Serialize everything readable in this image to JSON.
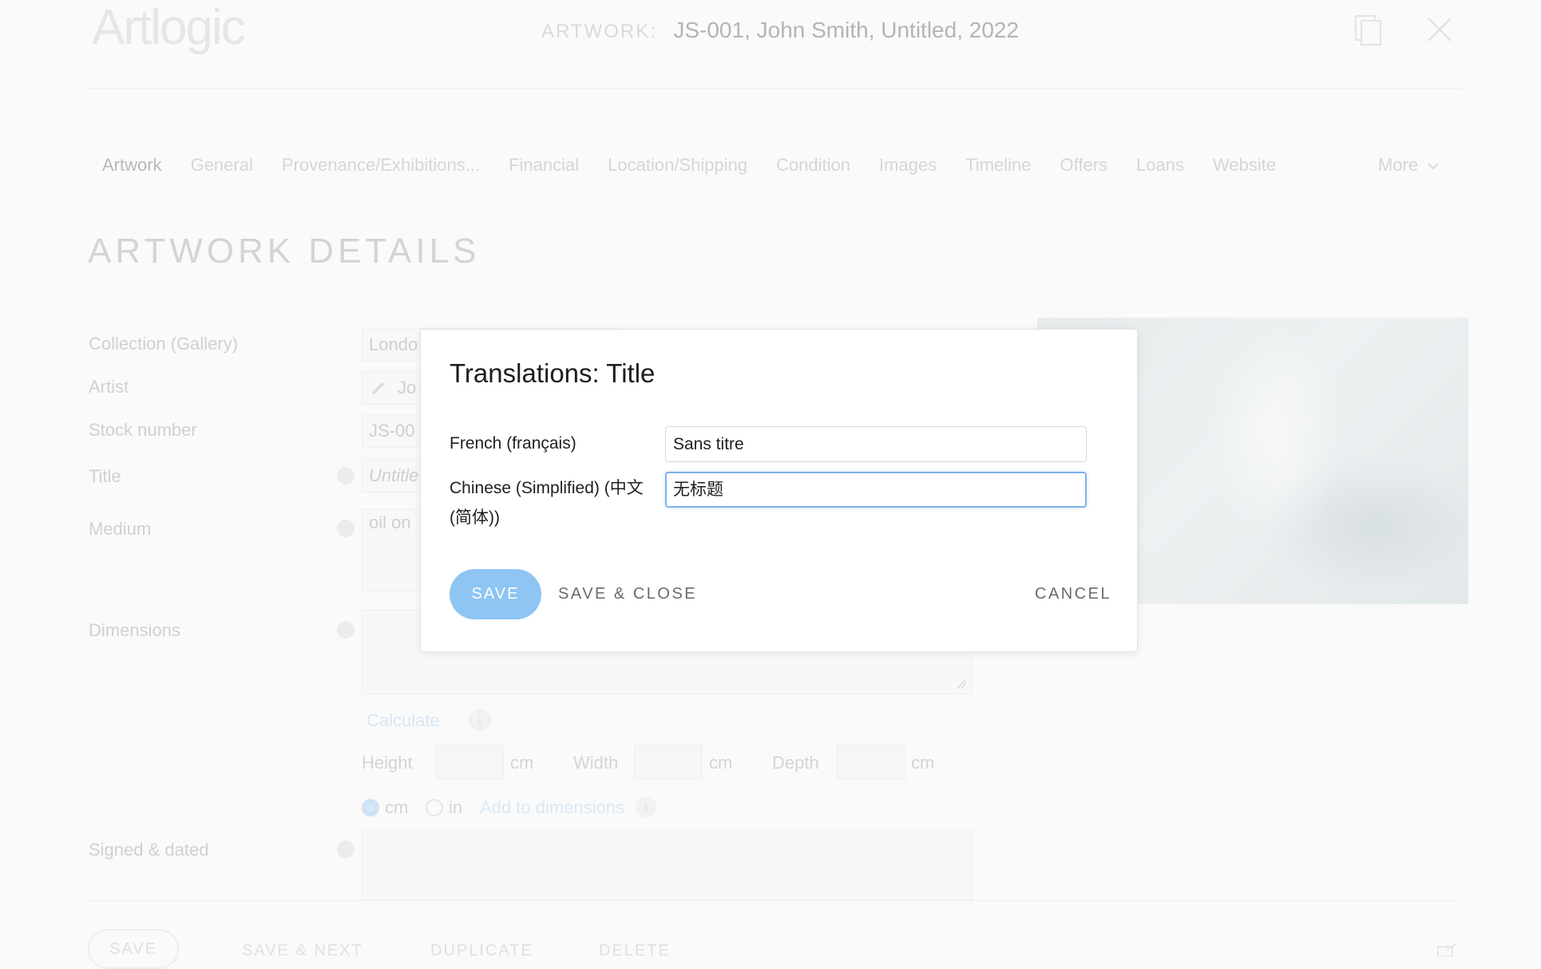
{
  "header": {
    "logo": "Artlogic",
    "artwork_label": "ARTWORK:",
    "artwork_value": "JS-001, John Smith, Untitled, 2022"
  },
  "tabs": [
    "Artwork",
    "General",
    "Provenance/Exhibitions...",
    "Financial",
    "Location/Shipping",
    "Condition",
    "Images",
    "Timeline",
    "Offers",
    "Loans",
    "Website"
  ],
  "more_label": "More",
  "section_title": "ARTWORK DETAILS",
  "fields": {
    "collection_label": "Collection (Gallery)",
    "collection_value": "Londo",
    "artist_label": "Artist",
    "artist_value": "Jo",
    "stock_label": "Stock number",
    "stock_value": "JS-00",
    "title_label": "Title",
    "title_value": "Untitle",
    "medium_label": "Medium",
    "medium_value": "oil on",
    "dimensions_label": "Dimensions",
    "calculate_label": "Calculate",
    "height_label": "Height",
    "width_label": "Width",
    "depth_label": "Depth",
    "unit_cm": "cm",
    "unit_in": "in",
    "add_to_dimensions": "Add to dimensions",
    "signed_label": "Signed & dated",
    "info_glyph": "i"
  },
  "bottom_actions": {
    "save": "SAVE",
    "save_next": "SAVE & NEXT",
    "duplicate": "DUPLICATE",
    "delete": "DELETE"
  },
  "modal": {
    "title": "Translations: Title",
    "french_label": "French (français)",
    "french_value": "Sans titre",
    "chinese_label": "Chinese (Simplified) (中文 (简体))",
    "chinese_value": "无标题",
    "save_label": "SAVE",
    "save_close_label": "SAVE & CLOSE",
    "cancel_label": "CANCEL"
  },
  "colors": {
    "accent": "#8ec5f3",
    "focus_border": "#7fb2e6",
    "modal_text": "#1d1d1d",
    "backdrop": "#fafafa"
  },
  "icons": [
    "copy-icon",
    "close-icon",
    "chevron-down-icon",
    "globe-icon",
    "info-icon",
    "pencil-icon",
    "external-link-icon",
    "resize-handle-icon"
  ]
}
